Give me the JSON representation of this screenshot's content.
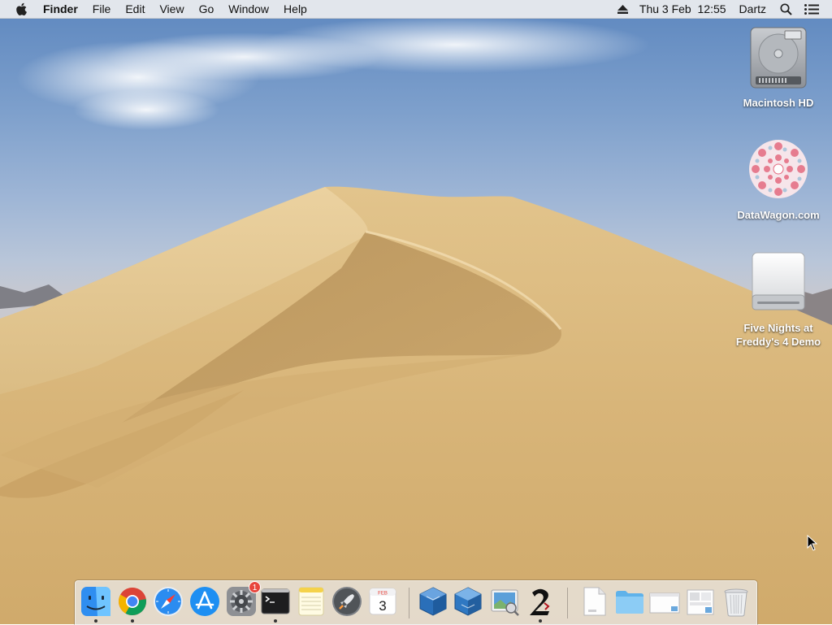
{
  "menubar": {
    "app_name": "Finder",
    "menus": [
      "File",
      "Edit",
      "View",
      "Go",
      "Window",
      "Help"
    ],
    "clock": "Thu 3 Feb  12:55",
    "user": "Dartz"
  },
  "desktop_icons": [
    {
      "label": "Macintosh HD"
    },
    {
      "label": "DataWagon.com"
    },
    {
      "label": "Five Nights at Freddy's 4 Demo"
    }
  ],
  "dock": {
    "apps": [
      {
        "name": "Finder",
        "running": true
      },
      {
        "name": "Google Chrome",
        "running": true
      },
      {
        "name": "Safari",
        "running": false
      },
      {
        "name": "App Store",
        "running": false
      },
      {
        "name": "System Preferences",
        "running": false,
        "badge": "1"
      },
      {
        "name": "Terminal",
        "running": true
      },
      {
        "name": "Notes",
        "running": false
      },
      {
        "name": "Launchpad",
        "running": false
      },
      {
        "name": "Calendar",
        "running": false,
        "month": "FEB",
        "day": "3"
      },
      {
        "name": "VirtualBox",
        "running": false
      },
      {
        "name": "VirtualBox VM",
        "running": false
      },
      {
        "name": "Preview",
        "running": false
      },
      {
        "name": "Five Nights at Freddy's 2",
        "running": true
      }
    ],
    "stacks": [
      {
        "name": "Document"
      },
      {
        "name": "Downloads"
      },
      {
        "name": "Screenshot"
      },
      {
        "name": "Screenshot 2"
      },
      {
        "name": "Trash"
      }
    ]
  },
  "colors": {
    "sky": "#7ea0cc",
    "dune": "#d7b67f",
    "badge": "#e8453c",
    "label_text": "#ffffff"
  }
}
